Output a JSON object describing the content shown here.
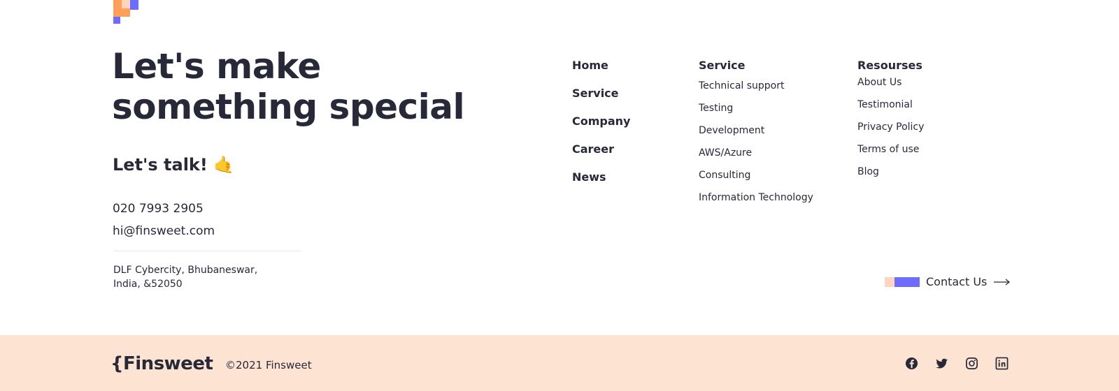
{
  "hero": {
    "headline_line1": "Let's make",
    "headline_line2": "something special",
    "talk": "Let's talk! 🤙",
    "phone": "020 7993 2905",
    "email": "hi@finsweet.com",
    "address_line1": "DLF Cybercity, Bhubaneswar,",
    "address_line2": "India, &52050"
  },
  "nav": {
    "main": [
      "Home",
      "Service",
      "Company",
      "Career",
      "News"
    ],
    "service": {
      "title": "Service",
      "items": [
        "Technical support",
        "Testing",
        "Development",
        "AWS/Azure",
        "Consulting",
        "Information Technology"
      ]
    },
    "resources": {
      "title": "Resourses",
      "items": [
        "About Us",
        "Testimonial",
        "Privacy Policy",
        "Terms of use",
        "Blog"
      ]
    }
  },
  "contact_cta": {
    "label": "Contact Us",
    "icon": "arrow-right-icon"
  },
  "footer": {
    "brand": "{Finsweet",
    "copyright": "©2021 Finsweet",
    "socials": [
      "facebook-icon",
      "twitter-icon",
      "instagram-icon",
      "linkedin-icon"
    ]
  },
  "colors": {
    "text": "#282938",
    "accent_purple": "#6c6cff",
    "accent_orange": "#ff9f5a",
    "accent_peach": "#fdd6bd",
    "footer_bg": "#fde4d2"
  }
}
